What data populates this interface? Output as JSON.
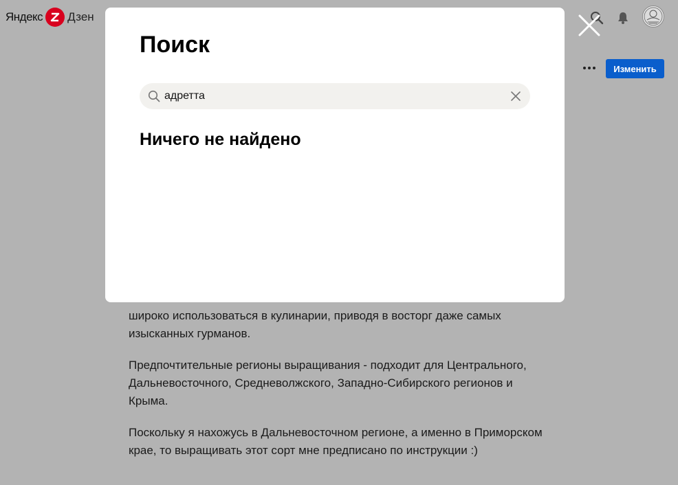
{
  "header": {
    "logo_brand": "Яндекс",
    "logo_product": "Дзен",
    "edit_label": "Изменить"
  },
  "search_modal": {
    "title": "Поиск",
    "query": "адретта",
    "empty_message": "Ничего не найдено"
  },
  "article": {
    "paragraphs": [
      "широко использоваться в кулинарии, приводя в восторг даже самых изысканных гурманов.",
      "Предпочтительные регионы выращивания - подходит для Центрального, Дальневосточного, Средневолжского, Западно-Сибирского регионов и Крыма.",
      "Поскольку я нахожусь в Дальневосточном регионе, а именно в Приморском крае, то выращивать этот сорт мне предписано по инструкции :)"
    ]
  },
  "colors": {
    "overlay_gray": "#b3b3b3",
    "brand_red": "#d8001e",
    "primary_blue": "#0a5ecc",
    "search_bg": "#f2f1ee"
  },
  "icons": [
    "yandex-zen-logo-icon",
    "search-icon",
    "bell-icon",
    "avatar",
    "more-icon",
    "close-icon",
    "clear-icon"
  ]
}
